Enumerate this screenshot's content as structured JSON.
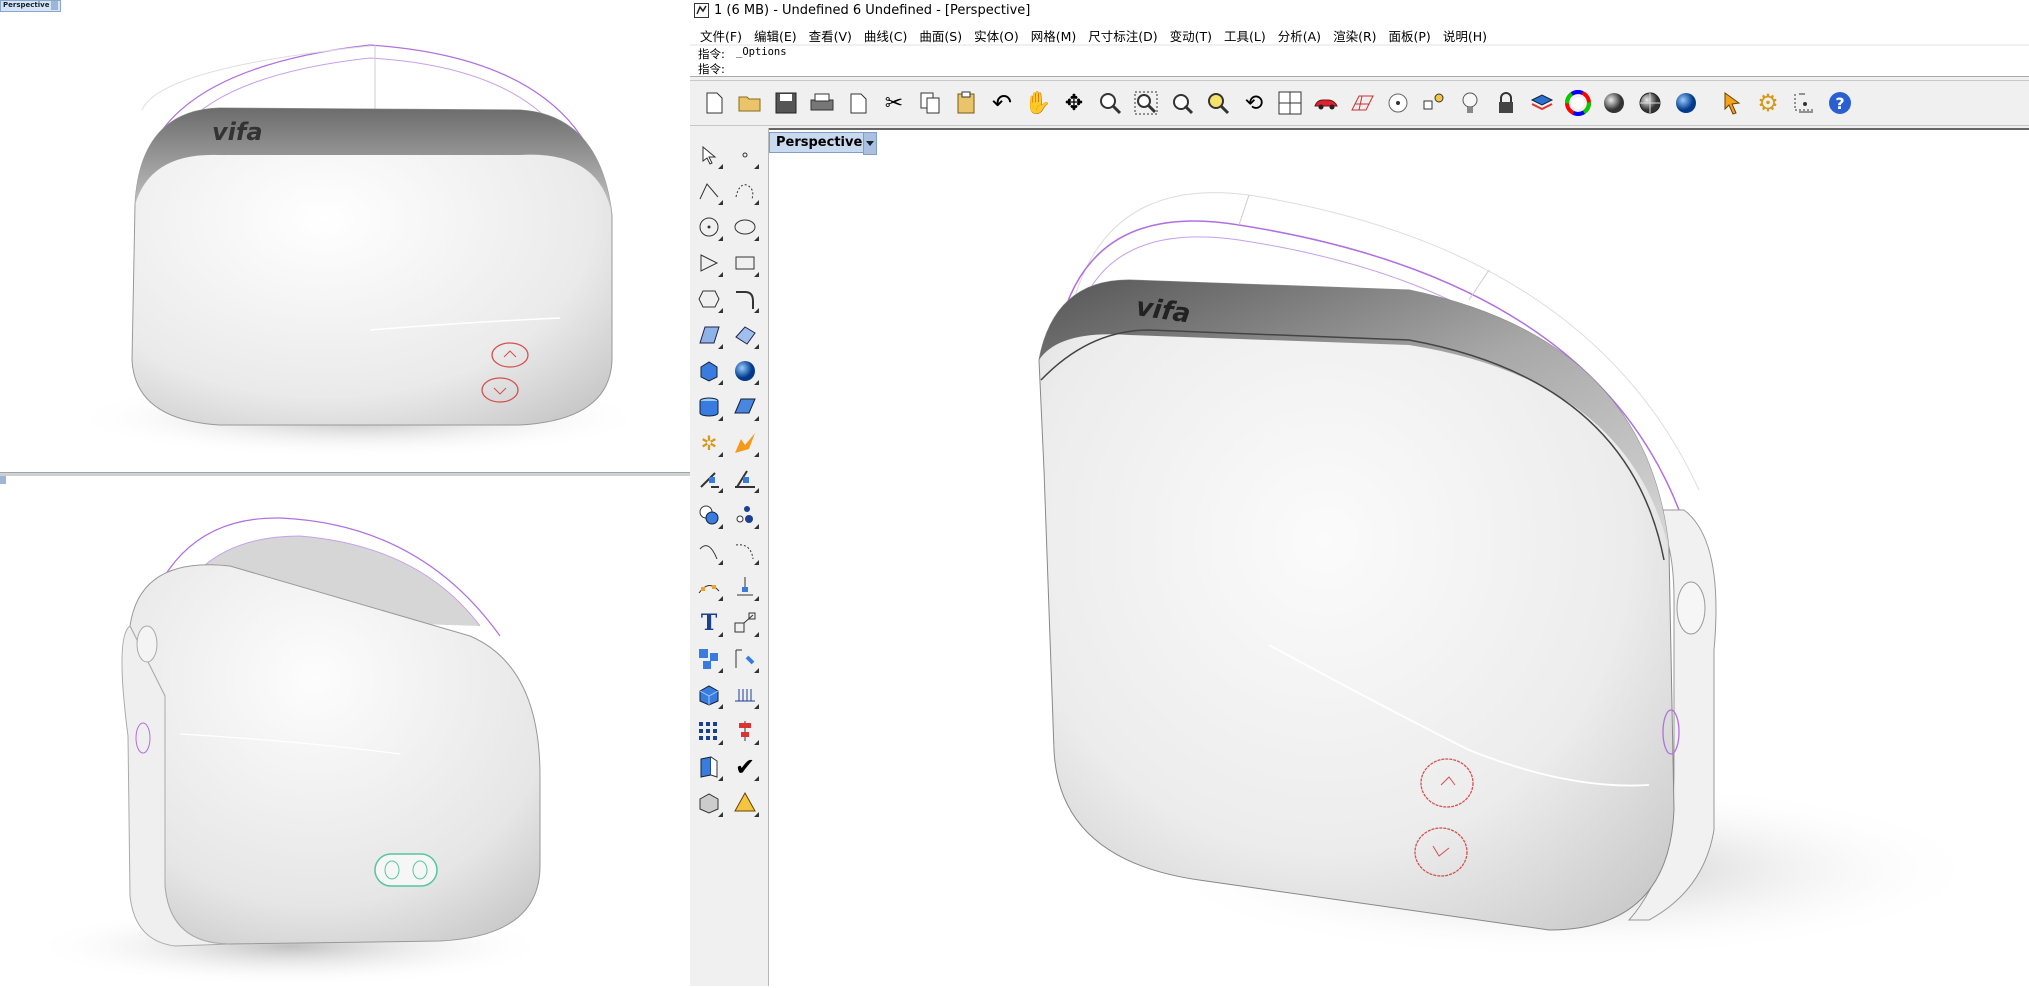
{
  "left_viewports": {
    "top_label": "Perspective",
    "brand_logo": "vifa"
  },
  "app": {
    "title": "1 (6 MB) - Undefined 6 Undefined - [Perspective]",
    "menu": [
      "文件(F)",
      "编辑(E)",
      "查看(V)",
      "曲线(C)",
      "曲面(S)",
      "实体(O)",
      "网格(M)",
      "尺寸标注(D)",
      "变动(T)",
      "工具(L)",
      "分析(A)",
      "渲染(R)",
      "面板(P)",
      "说明(H)"
    ],
    "command_history_label": "指令:",
    "command_history_value": "_Options",
    "command_prompt_label": "指令:",
    "command_input_value": ""
  },
  "toolbar": {
    "icons": [
      "new-file-icon",
      "open-folder-icon",
      "save-icon",
      "print-icon",
      "page-setup-icon",
      "cut-icon",
      "copy-icon",
      "paste-icon",
      "undo-icon",
      "pan-hand-icon",
      "rotate-view-icon",
      "zoom-icon",
      "zoom-window-icon",
      "zoom-extents-icon",
      "zoom-selected-icon",
      "rotate-camera-icon",
      "four-viewports-icon",
      "car-render-icon",
      "grid-plane-icon",
      "point-snap-icon",
      "object-snap-icon",
      "light-bulb-icon",
      "lock-icon",
      "layer-icon",
      "color-wheel-icon",
      "shaded-sphere-icon",
      "rendered-sphere-icon",
      "blue-sphere-icon",
      "select-filter-icon",
      "settings-gear-icon",
      "dimension-icon",
      "help-icon"
    ]
  },
  "sidebar": {
    "icons": [
      "select-arrow-icon",
      "point-icon",
      "polyline-icon",
      "curve-icon",
      "circle-icon",
      "ellipse-icon",
      "polygon-icon",
      "rectangle-icon",
      "hexagon-icon",
      "fillet-curve-icon",
      "surface-grid-icon",
      "surface-patch-icon",
      "box-solid-icon",
      "sphere-solid-icon",
      "cylinder-solid-icon",
      "mesh-plane-icon",
      "explode-icon",
      "burst-icon",
      "extend-icon",
      "trim-icon",
      "boolean-icon",
      "split-points-icon",
      "arc-icon",
      "fillet-icon",
      "array-curve-icon",
      "project-icon",
      "text-icon",
      "scale-icon",
      "group-icon",
      "transform-icon",
      "cube-icon",
      "grid-snap-icon",
      "array-grid-icon",
      "align-icon",
      "view-pages-icon",
      "check-icon",
      "shade-box-icon",
      "render-pyramid-icon"
    ]
  },
  "main_viewport": {
    "label": "Perspective",
    "brand_logo": "vifa"
  },
  "colors": {
    "viewport_tab": "#c9d9ee",
    "handle_curve": "#b070e0",
    "button_red": "#d65050"
  }
}
